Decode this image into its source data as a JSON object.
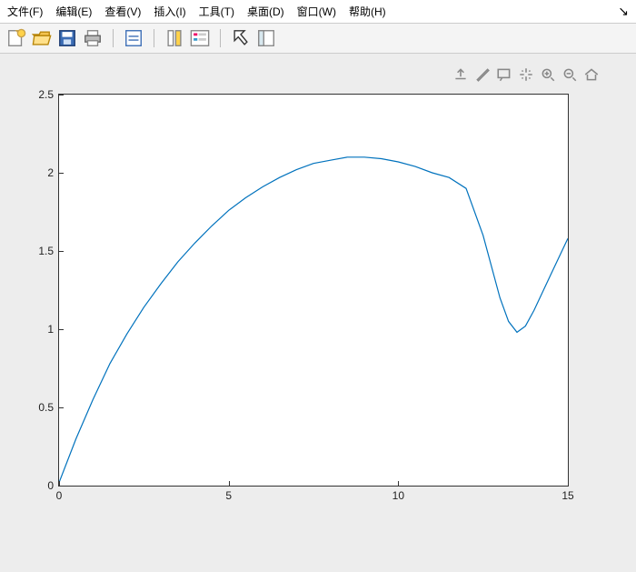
{
  "menu": {
    "file": "文件(F)",
    "edit": "编辑(E)",
    "view": "查看(V)",
    "insert": "插入(I)",
    "tools": "工具(T)",
    "desktop": "桌面(D)",
    "window": "窗口(W)",
    "help": "帮助(H)"
  },
  "chart_data": {
    "type": "line",
    "x": [
      0,
      0.5,
      1,
      1.5,
      2,
      2.5,
      3,
      3.5,
      4,
      4.5,
      5,
      5.5,
      6,
      6.5,
      7,
      7.5,
      8,
      8.5,
      9,
      9.5,
      10,
      10.5,
      11,
      11.5,
      12,
      12.5,
      13,
      13.25,
      13.5,
      13.75,
      14,
      14.5,
      15
    ],
    "y": [
      0.02,
      0.3,
      0.55,
      0.78,
      0.97,
      1.14,
      1.29,
      1.43,
      1.55,
      1.66,
      1.76,
      1.84,
      1.91,
      1.97,
      2.02,
      2.06,
      2.08,
      2.1,
      2.1,
      2.09,
      2.07,
      2.04,
      2.0,
      1.97,
      1.9,
      1.6,
      1.2,
      1.05,
      0.98,
      1.02,
      1.12,
      1.35,
      1.58
    ],
    "xlim": [
      0,
      15
    ],
    "ylim": [
      0,
      2.5
    ],
    "xticks": [
      0,
      5,
      10,
      15
    ],
    "yticks": [
      0,
      0.5,
      1,
      1.5,
      2,
      2.5
    ],
    "title": "",
    "xlabel": "",
    "ylabel": "",
    "line_color": "#0072BD"
  }
}
